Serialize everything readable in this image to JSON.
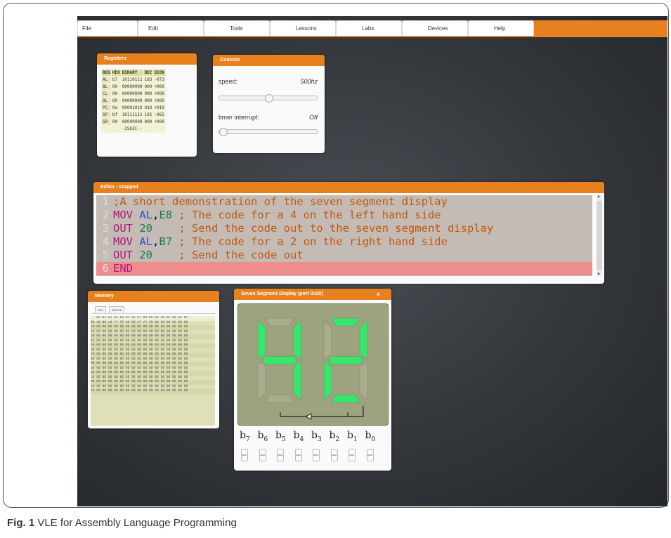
{
  "menu": [
    "File",
    "Edit",
    "Tools",
    "Lessons",
    "Labs",
    "Devices",
    "Help"
  ],
  "registers": {
    "title": "Registers",
    "headers": [
      "REG",
      "HEX",
      "BINARY",
      "DEC",
      "SIGN"
    ],
    "rows": [
      [
        "AL",
        "b7",
        "10110111",
        "183",
        "-073"
      ],
      [
        "BL",
        "00",
        "00000000",
        "000",
        "+000"
      ],
      [
        "CL",
        "00",
        "00000000",
        "000",
        "+000"
      ],
      [
        "DL",
        "00",
        "00000000",
        "000",
        "+000"
      ],
      [
        "PC",
        "0a",
        "00001010",
        "010",
        "+010"
      ],
      [
        "SP",
        "bf",
        "10111111",
        "191",
        "-065"
      ],
      [
        "SR",
        "00",
        "00000000",
        "000",
        "+000"
      ]
    ],
    "flags": "-ISOZC--"
  },
  "controls": {
    "title": "Controls",
    "speed_label": "speed:",
    "speed_value": "500hz",
    "speed_slider_level": 0.5,
    "timer_label": "timer interrupt:",
    "timer_value": "Off",
    "timer_slider_level": 0.0
  },
  "editor": {
    "title": "Editor - stopped",
    "lines": [
      {
        "num": "1",
        "tokens": [
          {
            "t": ";A short demonstration of the seven segment display",
            "c": "cmt"
          }
        ]
      },
      {
        "num": "2",
        "tokens": [
          {
            "t": "MOV",
            "c": "kw"
          },
          {
            "t": " ",
            "c": ""
          },
          {
            "t": "AL",
            "c": "reg"
          },
          {
            "t": ",",
            "c": ""
          },
          {
            "t": "E8",
            "c": "num"
          },
          {
            "t": " ; The code for a 4 on the left hand side",
            "c": "cmt"
          }
        ]
      },
      {
        "num": "3",
        "tokens": [
          {
            "t": "OUT",
            "c": "kw"
          },
          {
            "t": " ",
            "c": ""
          },
          {
            "t": "20",
            "c": "num"
          },
          {
            "t": "    ; Send the code out to the seven segment display",
            "c": "cmt"
          }
        ]
      },
      {
        "num": "4",
        "tokens": [
          {
            "t": "MOV",
            "c": "kw"
          },
          {
            "t": " ",
            "c": ""
          },
          {
            "t": "AL",
            "c": "reg"
          },
          {
            "t": ",",
            "c": ""
          },
          {
            "t": "B7",
            "c": "num"
          },
          {
            "t": " ; The code for a 2 on the right hand side",
            "c": "cmt"
          }
        ]
      },
      {
        "num": "5",
        "tokens": [
          {
            "t": "OUT",
            "c": "kw"
          },
          {
            "t": " ",
            "c": ""
          },
          {
            "t": "20",
            "c": "num"
          },
          {
            "t": "    ; Send the code out",
            "c": "cmt"
          }
        ]
      },
      {
        "num": "6",
        "tokens": [
          {
            "t": "END",
            "c": "kw"
          }
        ]
      }
    ],
    "highlight_line": 6
  },
  "memory": {
    "title": "Memory",
    "tabs": [
      "Hex",
      "Source"
    ],
    "header": "   00 01 02 03 04 05 06 07 08 09 0a 0b 0c 0d 0e 0f",
    "rows": [
      "00 d0 00 e8 f1 20 d0 00 b7 f1 20 00 00 00 00 00 00",
      "10 00 00 00 00 00 00 00 00 00 00 00 00 00 00 00 00",
      "20 00 00 00 00 00 00 00 00 00 00 00 00 00 00 00 00",
      "30 00 00 00 00 00 00 00 00 00 00 00 00 00 00 00 00",
      "40 00 00 00 00 00 00 00 00 00 00 00 00 00 00 00 00",
      "50 00 00 00 00 00 00 00 00 00 00 00 00 00 00 00 00",
      "60 00 00 00 00 00 00 00 00 00 00 00 00 00 00 00 00",
      "70 00 00 00 00 00 00 00 00 00 00 00 00 00 00 00 00",
      "80 00 00 00 00 00 00 00 00 00 00 00 00 00 00 00 00",
      "90 00 00 00 00 00 00 00 00 00 00 00 00 00 00 00 00",
      "a0 00 00 00 00 00 00 00 00 00 00 00 00 00 00 00 00",
      "b0 00 00 00 00 00 00 00 00 00 00 00 00 00 00 00 00",
      "c0 00 00 00 00 00 00 00 00 00 00 00 00 00 00 00 00",
      "d0 00 00 00 00 00 00 00 00 00 00 00 00 00 00 00 00",
      "e0 00 00 00 00 00 00 00 00 00 00 00 00 00 00 00 00",
      "f0 00 00 00 00 00 00 00 00 00 00 00 00 00 00 00 00"
    ]
  },
  "seven_segment": {
    "title": "Seven Segment Display (port 0x20)",
    "close": "×",
    "left_digit": "4",
    "right_digit": "2",
    "bit_labels": [
      "b",
      "b",
      "b",
      "b",
      "b",
      "b",
      "b",
      "b"
    ],
    "bit_subs": [
      "7",
      "6",
      "5",
      "4",
      "3",
      "2",
      "1",
      "0"
    ]
  },
  "colors": {
    "accent": "#e8801e",
    "segment_on": "#33e86a",
    "segment_off": "#a9ad8d",
    "highlight_line": "#ee8e8c"
  },
  "caption": {
    "label": "Fig. 1",
    "text": " VLE for Assembly Language Programming"
  }
}
